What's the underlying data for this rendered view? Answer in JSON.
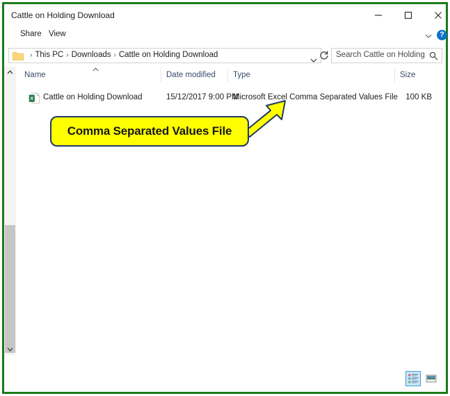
{
  "window": {
    "title": "Cattle on Holding Download",
    "controls": {
      "minimize": "minimize-button",
      "maximize": "maximize-button",
      "close": "close-button"
    },
    "frame_color": "#1a7a1a"
  },
  "ribbon": {
    "tabs": [
      {
        "label": "Share"
      },
      {
        "label": "View"
      }
    ],
    "expand_label": "",
    "help_label": "?"
  },
  "address": {
    "breadcrumb": [
      {
        "label": "This PC"
      },
      {
        "label": "Downloads"
      },
      {
        "label": "Cattle on Holding Download"
      }
    ],
    "separator": "›"
  },
  "search": {
    "value": "",
    "placeholder": "Search Cattle on Holding Do..."
  },
  "columns": [
    {
      "key": "name",
      "label": "Name"
    },
    {
      "key": "date",
      "label": "Date modified"
    },
    {
      "key": "type",
      "label": "Type"
    },
    {
      "key": "size",
      "label": "Size"
    }
  ],
  "sort": {
    "column": "Name",
    "direction": "ascending"
  },
  "files": [
    {
      "name": "Cattle on Holding Download",
      "date_modified": "15/12/2017 9:00 PM",
      "type": "Microsoft Excel Comma Separated Values File",
      "size": "100 KB",
      "icon": "csv-excel-file-icon"
    }
  ],
  "annotation": {
    "text": "Comma Separated Values File",
    "fill_color": "#ffff00",
    "border_color": "#1f3864",
    "arrow_target": "file-type-cell"
  },
  "status_bar": {
    "views": [
      {
        "name": "details-view",
        "selected": true
      },
      {
        "name": "large-icons-view",
        "selected": false
      }
    ]
  }
}
